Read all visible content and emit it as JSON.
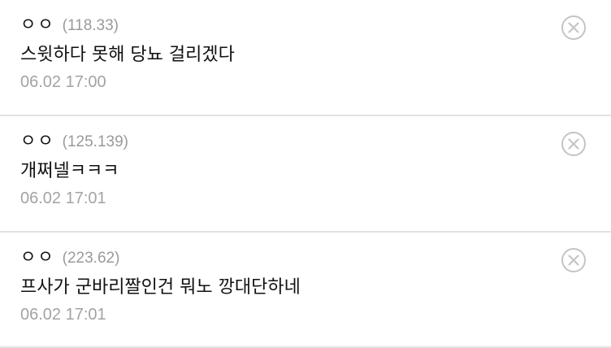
{
  "comments": [
    {
      "nickname": "ㅇㅇ",
      "ip": "(118.33)",
      "text": "스윗하다 못해 당뇨 걸리겠다",
      "time": "06.02 17:00",
      "delete_icon": "close-circle-icon"
    },
    {
      "nickname": "ㅇㅇ",
      "ip": "(125.139)",
      "text": "개쩌넬ㅋㅋㅋ",
      "time": "06.02 17:01",
      "delete_icon": "close-circle-icon"
    },
    {
      "nickname": "ㅇㅇ",
      "ip": "(223.62)",
      "text": "프사가 군바리짤인건 뭐노 깡대단하네",
      "time": "06.02 17:01",
      "delete_icon": "close-circle-icon"
    }
  ],
  "colors": {
    "text": "#111111",
    "muted": "#9a9a9a",
    "divider": "#e2e2e2",
    "icon": "#c4c4c4"
  }
}
